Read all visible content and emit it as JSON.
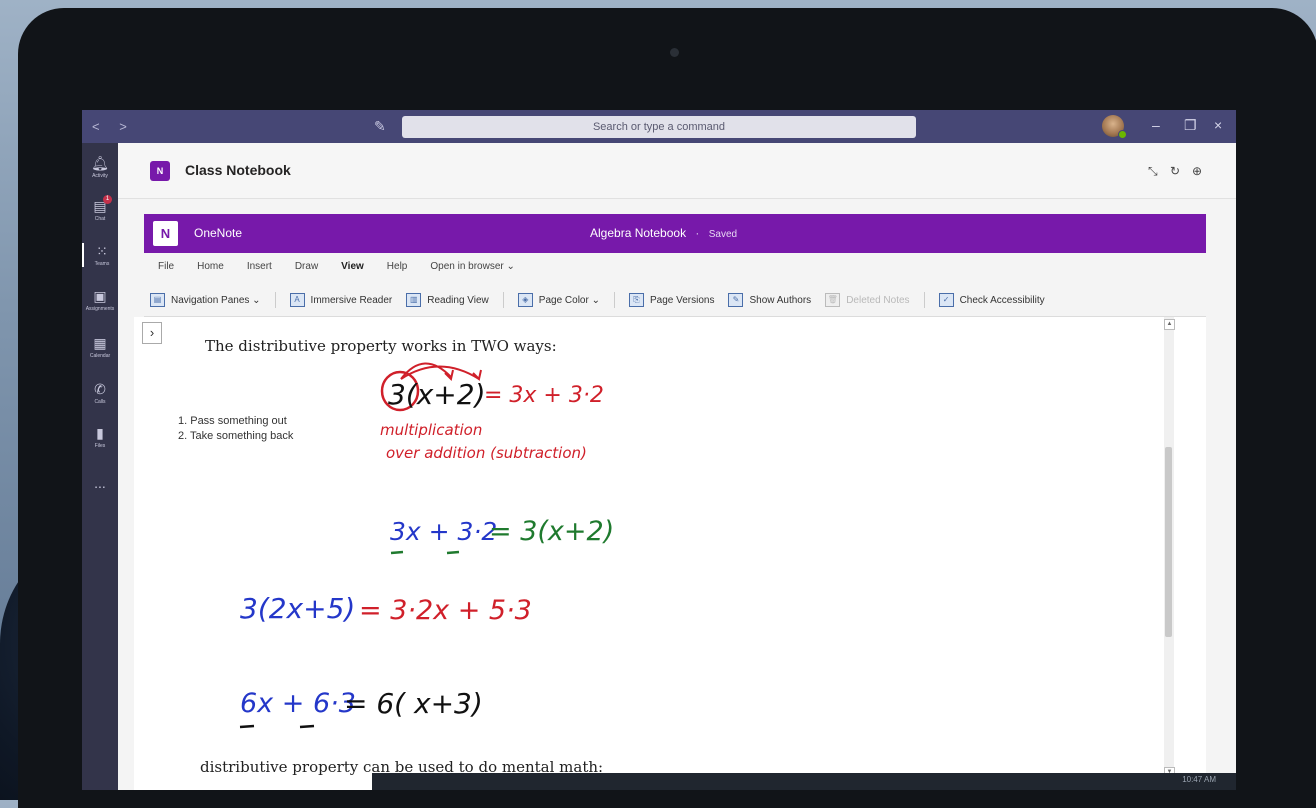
{
  "teams": {
    "search_placeholder": "Search or type a command",
    "rail": [
      {
        "label": "Activity",
        "icon": "bell-icon"
      },
      {
        "label": "Chat",
        "icon": "chat-icon",
        "badge": "1"
      },
      {
        "label": "Teams",
        "icon": "teams-icon"
      },
      {
        "label": "Assignments",
        "icon": "assignments-icon"
      },
      {
        "label": "Calendar",
        "icon": "calendar-icon"
      },
      {
        "label": "Calls",
        "icon": "phone-icon"
      },
      {
        "label": "Files",
        "icon": "file-icon"
      },
      {
        "label": "...",
        "icon": "more-icon"
      }
    ],
    "tab_title": "Class Notebook"
  },
  "onenote": {
    "app_name": "OneNote",
    "doc_name": "Algebra Notebook",
    "status": "Saved",
    "menu": [
      "File",
      "Home",
      "Insert",
      "Draw",
      "View",
      "Help",
      "Open in browser ⌄"
    ],
    "active_menu": "View",
    "ribbon": [
      {
        "label": "Navigation Panes ⌄",
        "icon": "navigation-panes-icon"
      },
      {
        "label": "Immersive Reader",
        "icon": "immersive-reader-icon"
      },
      {
        "label": "Reading View",
        "icon": "reading-view-icon"
      },
      {
        "label": "Page Color ⌄",
        "icon": "page-color-icon"
      },
      {
        "label": "Page Versions",
        "icon": "page-versions-icon"
      },
      {
        "label": "Show Authors",
        "icon": "show-authors-icon"
      },
      {
        "label": "Deleted Notes",
        "icon": "deleted-notes-icon",
        "disabled": true
      },
      {
        "label": "Check Accessibility",
        "icon": "check-accessibility-icon"
      }
    ]
  },
  "page": {
    "heading": "The distributive property works in TWO ways:",
    "list": [
      "1.  Pass something out",
      "2.  Take something back"
    ],
    "bottom": "distributive property can be used to do mental math:",
    "ink": {
      "eq1_black": "3(x+2)",
      "eq1_red": "= 3x + 3·2",
      "note1": "multiplication",
      "note2": "over addition (subtraction)",
      "eq2_blue": "3x + 3·2",
      "eq2_green": "= 3(x+2)",
      "eq3_blue": "3(2x+5)",
      "eq3_red": "= 3·2x + 5·3",
      "eq4_blue": "6x + 6·3",
      "eq4_black": "=  6( x+3)"
    }
  },
  "taskbar": {
    "time": "10:47 AM"
  }
}
